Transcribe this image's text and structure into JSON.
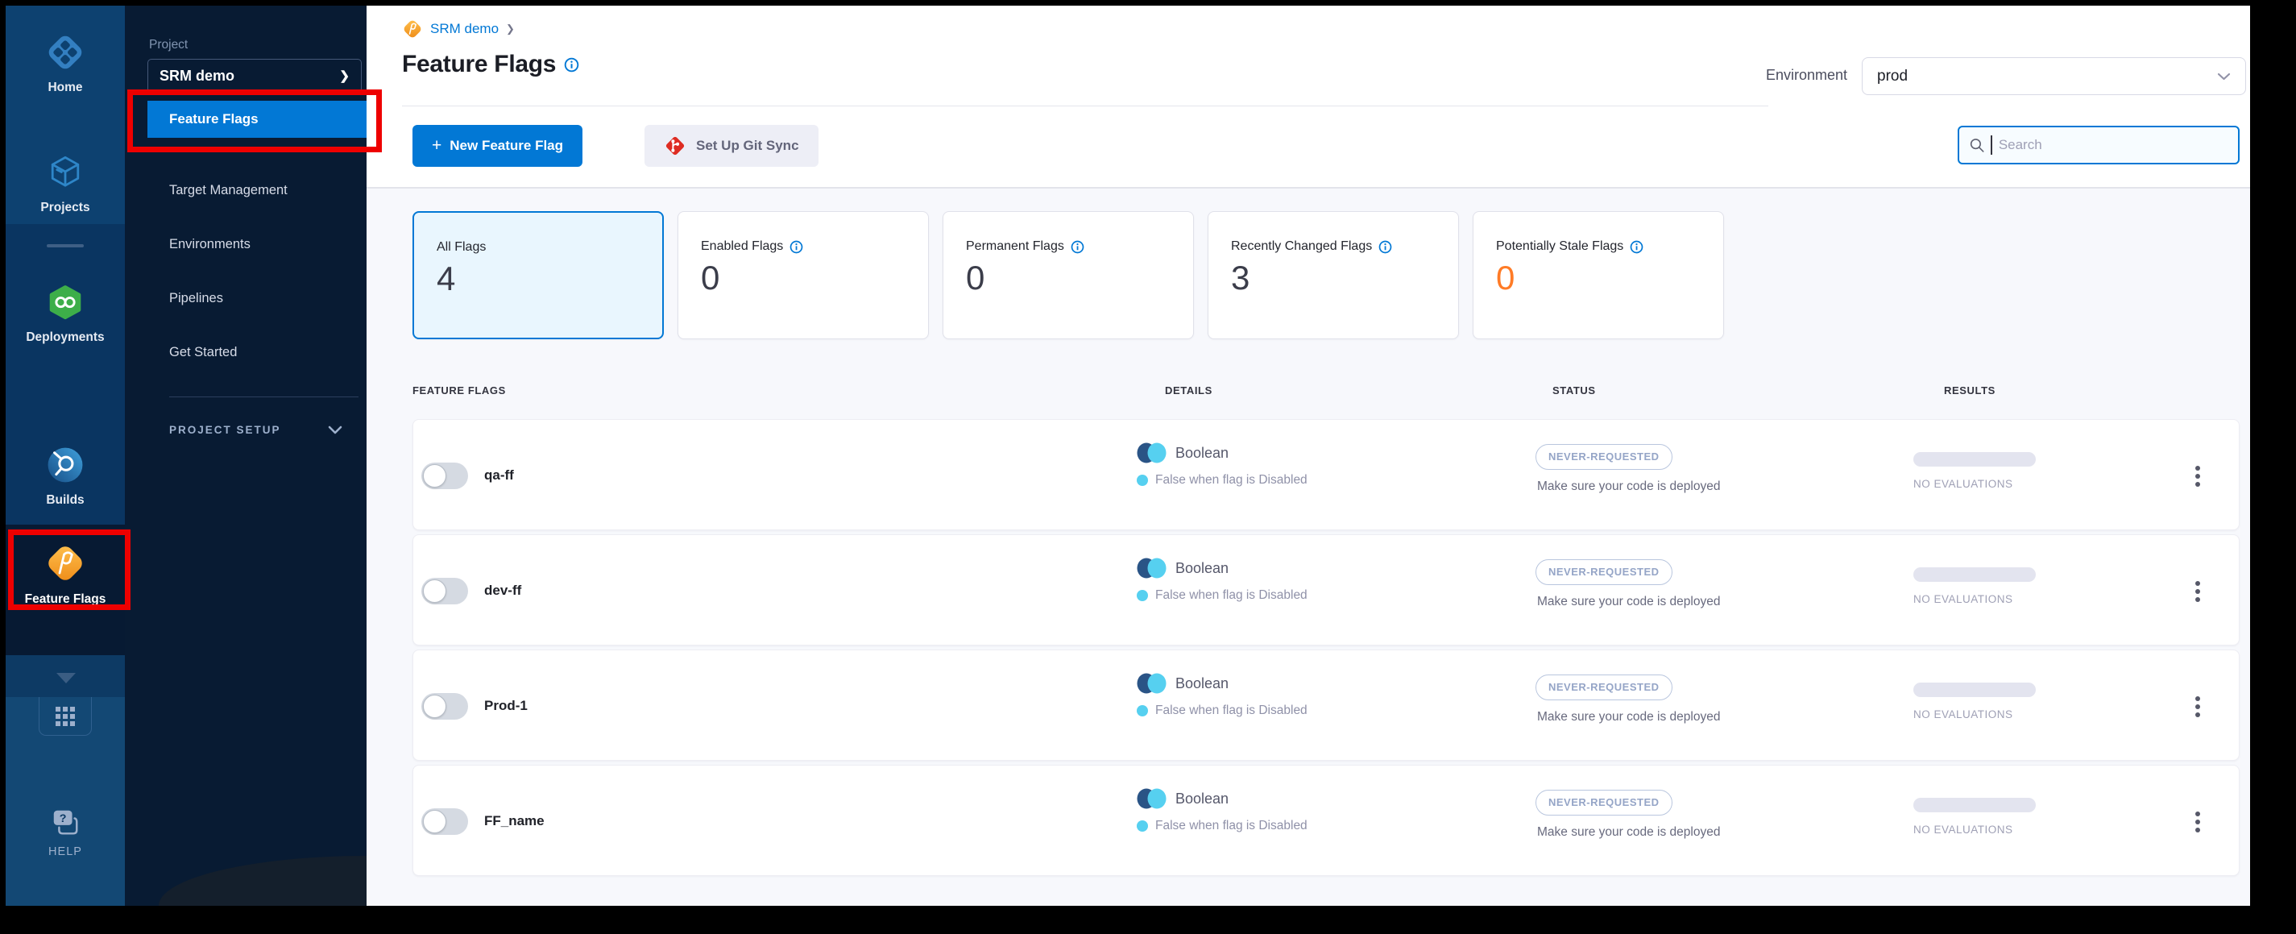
{
  "sidebar": {
    "items": [
      {
        "label": "Home"
      },
      {
        "label": "Projects"
      },
      {
        "label": "Deployments"
      },
      {
        "label": "Builds"
      },
      {
        "label": "Feature Flags"
      }
    ],
    "help_label": "HELP"
  },
  "project_panel": {
    "section_label": "Project",
    "project_name": "SRM demo",
    "nav": [
      {
        "label": "Feature Flags",
        "active": true
      },
      {
        "label": "Target Management"
      },
      {
        "label": "Environments"
      },
      {
        "label": "Pipelines"
      },
      {
        "label": "Get Started"
      }
    ],
    "setup_label": "PROJECT SETUP"
  },
  "header": {
    "breadcrumb": "SRM demo",
    "title": "Feature Flags",
    "environment_label": "Environment",
    "environment_value": "prod"
  },
  "toolbar": {
    "plus": "+",
    "new_flag_label": "New Feature Flag",
    "git_sync_label": "Set Up Git Sync",
    "search_placeholder": "Search"
  },
  "stats": [
    {
      "label": "All Flags",
      "value": "4",
      "selected": true
    },
    {
      "label": "Enabled Flags",
      "value": "0"
    },
    {
      "label": "Permanent Flags",
      "value": "0"
    },
    {
      "label": "Recently Changed Flags",
      "value": "3"
    },
    {
      "label": "Potentially Stale Flags",
      "value": "0"
    }
  ],
  "table": {
    "headers": [
      "FEATURE FLAGS",
      "DETAILS",
      "STATUS",
      "RESULTS"
    ],
    "rows": [
      {
        "name": "qa-ff",
        "type": "Boolean",
        "rule": "False when flag is Disabled",
        "badge": "NEVER-REQUESTED",
        "status_note": "Make sure your code is deployed",
        "results_note": "NO EVALUATIONS"
      },
      {
        "name": "dev-ff",
        "type": "Boolean",
        "rule": "False when flag is Disabled",
        "badge": "NEVER-REQUESTED",
        "status_note": "Make sure your code is deployed",
        "results_note": "NO EVALUATIONS"
      },
      {
        "name": "Prod-1",
        "type": "Boolean",
        "rule": "False when flag is Disabled",
        "badge": "NEVER-REQUESTED",
        "status_note": "Make sure your code is deployed",
        "results_note": "NO EVALUATIONS"
      },
      {
        "name": "FF_name",
        "type": "Boolean",
        "rule": "False when flag is Disabled",
        "badge": "NEVER-REQUESTED",
        "status_note": "Make sure your code is deployed",
        "results_note": "NO EVALUATIONS"
      }
    ]
  },
  "icons": {
    "breadcrumb_chevron": "❯",
    "project_box_chevron": "❯"
  },
  "colors": {
    "primary": "#0278d5",
    "stale_value": "#ff7b26",
    "annotation_red": "#ee0000",
    "sidebar_dark": "#081b33"
  }
}
